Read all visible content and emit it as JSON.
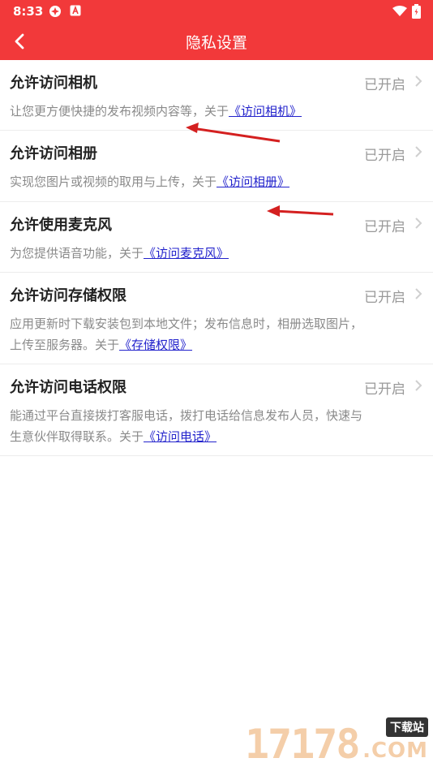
{
  "status_bar": {
    "time": "8:33"
  },
  "header": {
    "title": "隐私设置"
  },
  "items": [
    {
      "title": "允许访问相机",
      "status": "已开启",
      "desc_text": "让您更方便快捷的发布视频内容等，关于",
      "link": "《访问相机》",
      "desc_line1": "",
      "desc_line2": ""
    },
    {
      "title": "允许访问相册",
      "status": "已开启",
      "desc_text": "实现您图片或视频的取用与上传，关于",
      "link": "《访问相册》"
    },
    {
      "title": "允许使用麦克风",
      "status": "已开启",
      "desc_text": "为您提供语音功能，关于",
      "link": "《访问麦克风》"
    },
    {
      "title": "允许访问存储权限",
      "status": "已开启",
      "desc_line1": "应用更新时下载安装包到本地文件；发布信息时，相册选取图片，",
      "desc_text": "上传至服务器。关于",
      "link": "《存储权限》"
    },
    {
      "title": "允许访问电话权限",
      "status": "已开启",
      "desc_line1": "能通过平台直接拨打客服电话，拨打电话给信息发布人员，快速与",
      "desc_text": "生意伙伴取得联系。关于",
      "link": "《访问电话》"
    }
  ],
  "watermark": {
    "number": "17178",
    "badge": "下载站",
    "domain": ".COM"
  },
  "colors": {
    "header_bg": "#f2393a",
    "link": "#2323cc",
    "annotation_arrow": "#d42020"
  }
}
